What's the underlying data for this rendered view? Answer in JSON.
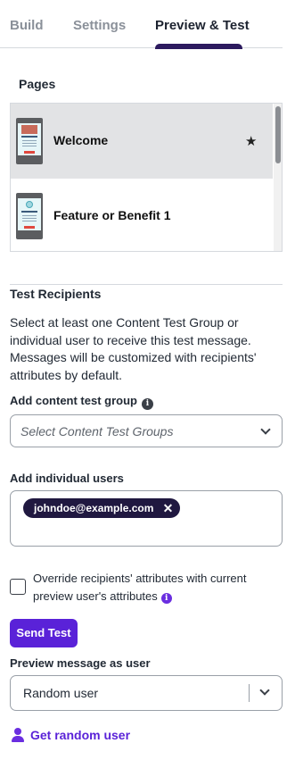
{
  "tabs": [
    {
      "label": "Build",
      "active": false
    },
    {
      "label": "Settings",
      "active": false
    },
    {
      "label": "Preview & Test",
      "active": true
    }
  ],
  "pages": {
    "title": "Pages",
    "items": [
      {
        "name": "Welcome",
        "selected": true,
        "starred": true
      },
      {
        "name": "Feature or Benefit 1",
        "selected": false,
        "starred": false
      }
    ]
  },
  "test_recipients": {
    "title": "Test Recipients",
    "description": "Select at least one Content Test Group or individual user to receive this test message. Messages will be customized with recipients' attributes by default.",
    "content_group_label": "Add content test group",
    "content_group_placeholder": "Select Content Test Groups",
    "individual_users_label": "Add individual users",
    "users": [
      "johndoe@example.com"
    ],
    "chip_remove": "✕",
    "override_label": "Override recipients' attributes with current preview user's attributes",
    "override_checked": false,
    "send_button": "Send Test"
  },
  "preview": {
    "label": "Preview message as user",
    "selected_user": "Random user",
    "random_link": "Get random user"
  },
  "icons": {
    "star": "★",
    "info": "i"
  },
  "colors": {
    "accent": "#5a22d8",
    "chip_bg": "#201840",
    "tab_indicator": "#2c1a5e",
    "selected_row": "#e2e3e5"
  }
}
